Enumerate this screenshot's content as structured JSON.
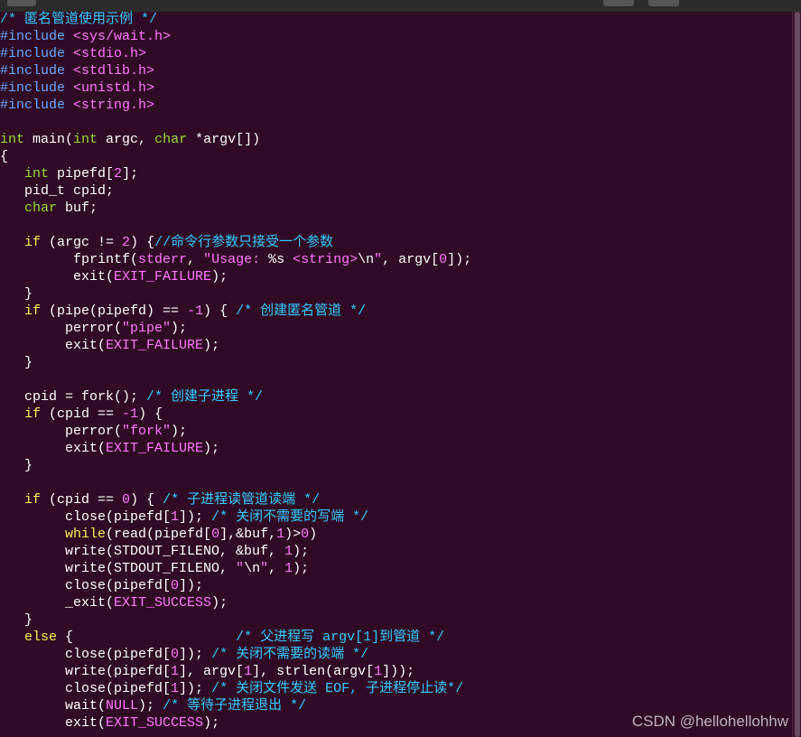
{
  "editor": {
    "colors": {
      "background": "#300a24",
      "comment": "#33ccff",
      "preproc": "#66aaff",
      "header": "#ff77ff",
      "type": "#99dd33",
      "keyword": "#ffee55",
      "literal": "#ff77ff",
      "text": "#ffffff"
    },
    "lines": [
      [
        [
          "comment",
          "/* 匿名管道使用示例 */"
        ]
      ],
      [
        [
          "preproc",
          "#include "
        ],
        [
          "header",
          "<sys/wait.h>"
        ]
      ],
      [
        [
          "preproc",
          "#include "
        ],
        [
          "header",
          "<stdio.h>"
        ]
      ],
      [
        [
          "preproc",
          "#include "
        ],
        [
          "header",
          "<stdlib.h>"
        ]
      ],
      [
        [
          "preproc",
          "#include "
        ],
        [
          "header",
          "<unistd.h>"
        ]
      ],
      [
        [
          "preproc",
          "#include "
        ],
        [
          "header",
          "<string.h>"
        ]
      ],
      [],
      [
        [
          "type",
          "int"
        ],
        [
          "text",
          " main("
        ],
        [
          "type",
          "int"
        ],
        [
          "text",
          " argc, "
        ],
        [
          "type",
          "char"
        ],
        [
          "text",
          " *argv[])"
        ]
      ],
      [
        [
          "text",
          "{"
        ]
      ],
      [
        [
          "text",
          "   "
        ],
        [
          "type",
          "int"
        ],
        [
          "text",
          " pipefd["
        ],
        [
          "number",
          "2"
        ],
        [
          "text",
          "];"
        ]
      ],
      [
        [
          "text",
          "   pid_t cpid;"
        ]
      ],
      [
        [
          "text",
          "   "
        ],
        [
          "type",
          "char"
        ],
        [
          "text",
          " buf;"
        ]
      ],
      [],
      [
        [
          "text",
          "   "
        ],
        [
          "keyword",
          "if"
        ],
        [
          "text",
          " (argc != "
        ],
        [
          "number",
          "2"
        ],
        [
          "text",
          ") {"
        ],
        [
          "comment",
          "//命令行参数只接受一个参数"
        ]
      ],
      [
        [
          "text",
          "         fprintf("
        ],
        [
          "const",
          "stderr"
        ],
        [
          "text",
          ", "
        ],
        [
          "string",
          "\"Usage: "
        ],
        [
          "text",
          "%s "
        ],
        [
          "string",
          "<string>"
        ],
        [
          "text",
          "\\n"
        ],
        [
          "string",
          "\""
        ],
        [
          "text",
          ", argv["
        ],
        [
          "number",
          "0"
        ],
        [
          "text",
          "]);"
        ]
      ],
      [
        [
          "text",
          "         exit("
        ],
        [
          "const",
          "EXIT_FAILURE"
        ],
        [
          "text",
          ");"
        ]
      ],
      [
        [
          "text",
          "   }"
        ]
      ],
      [
        [
          "text",
          "   "
        ],
        [
          "keyword",
          "if"
        ],
        [
          "text",
          " (pipe(pipefd) == "
        ],
        [
          "number",
          "-1"
        ],
        [
          "text",
          ") { "
        ],
        [
          "comment",
          "/* 创建匿名管道 */"
        ]
      ],
      [
        [
          "text",
          "        perror("
        ],
        [
          "string",
          "\"pipe\""
        ],
        [
          "text",
          ");"
        ]
      ],
      [
        [
          "text",
          "        exit("
        ],
        [
          "const",
          "EXIT_FAILURE"
        ],
        [
          "text",
          ");"
        ]
      ],
      [
        [
          "text",
          "   }"
        ]
      ],
      [],
      [
        [
          "text",
          "   cpid = fork(); "
        ],
        [
          "comment",
          "/* 创建子进程 */"
        ]
      ],
      [
        [
          "text",
          "   "
        ],
        [
          "keyword",
          "if"
        ],
        [
          "text",
          " (cpid == "
        ],
        [
          "number",
          "-1"
        ],
        [
          "text",
          ") {"
        ]
      ],
      [
        [
          "text",
          "        perror("
        ],
        [
          "string",
          "\"fork\""
        ],
        [
          "text",
          ");"
        ]
      ],
      [
        [
          "text",
          "        exit("
        ],
        [
          "const",
          "EXIT_FAILURE"
        ],
        [
          "text",
          ");"
        ]
      ],
      [
        [
          "text",
          "   }"
        ]
      ],
      [],
      [
        [
          "text",
          "   "
        ],
        [
          "keyword",
          "if"
        ],
        [
          "text",
          " (cpid == "
        ],
        [
          "number",
          "0"
        ],
        [
          "text",
          ") { "
        ],
        [
          "comment",
          "/* 子进程读管道读端 */"
        ]
      ],
      [
        [
          "text",
          "        close(pipefd["
        ],
        [
          "number",
          "1"
        ],
        [
          "text",
          "]); "
        ],
        [
          "comment",
          "/* 关闭不需要的写端 */"
        ]
      ],
      [
        [
          "text",
          "        "
        ],
        [
          "keyword",
          "while"
        ],
        [
          "text",
          "(read(pipefd["
        ],
        [
          "number",
          "0"
        ],
        [
          "text",
          "],&buf,"
        ],
        [
          "number",
          "1"
        ],
        [
          "text",
          ")>"
        ],
        [
          "number",
          "0"
        ],
        [
          "text",
          ")"
        ]
      ],
      [
        [
          "text",
          "        write(STDOUT_FILENO, &buf, "
        ],
        [
          "number",
          "1"
        ],
        [
          "text",
          ");"
        ]
      ],
      [
        [
          "text",
          "        write(STDOUT_FILENO, "
        ],
        [
          "string",
          "\""
        ],
        [
          "text",
          "\\n"
        ],
        [
          "string",
          "\""
        ],
        [
          "text",
          ", "
        ],
        [
          "number",
          "1"
        ],
        [
          "text",
          ");"
        ]
      ],
      [
        [
          "text",
          "        close(pipefd["
        ],
        [
          "number",
          "0"
        ],
        [
          "text",
          "]);"
        ]
      ],
      [
        [
          "text",
          "        _exit("
        ],
        [
          "const",
          "EXIT_SUCCESS"
        ],
        [
          "text",
          ");"
        ]
      ],
      [
        [
          "text",
          "   }"
        ]
      ],
      [
        [
          "text",
          "   "
        ],
        [
          "keyword",
          "else"
        ],
        [
          "text",
          " {                    "
        ],
        [
          "comment",
          "/* 父进程写 argv[1]到管道 */"
        ]
      ],
      [
        [
          "text",
          "        close(pipefd["
        ],
        [
          "number",
          "0"
        ],
        [
          "text",
          "]); "
        ],
        [
          "comment",
          "/* 关闭不需要的读端 */"
        ]
      ],
      [
        [
          "text",
          "        write(pipefd["
        ],
        [
          "number",
          "1"
        ],
        [
          "text",
          "], argv["
        ],
        [
          "number",
          "1"
        ],
        [
          "text",
          "], strlen(argv["
        ],
        [
          "number",
          "1"
        ],
        [
          "text",
          "]));"
        ]
      ],
      [
        [
          "text",
          "        close(pipefd["
        ],
        [
          "number",
          "1"
        ],
        [
          "text",
          "]); "
        ],
        [
          "comment",
          "/* 关闭文件发送 EOF, 子进程停止读*/"
        ]
      ],
      [
        [
          "text",
          "        wait("
        ],
        [
          "const",
          "NULL"
        ],
        [
          "text",
          "); "
        ],
        [
          "comment",
          "/* 等待子进程退出 */"
        ]
      ],
      [
        [
          "text",
          "        exit("
        ],
        [
          "const",
          "EXIT_SUCCESS"
        ],
        [
          "text",
          ");"
        ]
      ]
    ]
  },
  "watermark": "CSDN @hellohellohhw"
}
